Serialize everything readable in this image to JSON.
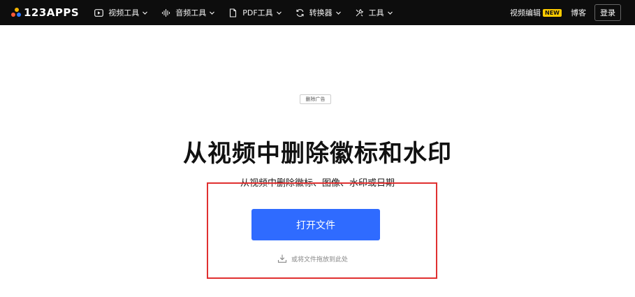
{
  "brand": {
    "name": "123APPS"
  },
  "nav": {
    "items": [
      {
        "label": "视频工具",
        "icon": "play-icon"
      },
      {
        "label": "音频工具",
        "icon": "audio-wave-icon"
      },
      {
        "label": "PDF工具",
        "icon": "document-icon"
      },
      {
        "label": "转换器",
        "icon": "convert-icon"
      },
      {
        "label": "工具",
        "icon": "tools-icon"
      }
    ]
  },
  "right_nav": {
    "video_editor": "视频编辑",
    "new_badge": "NEW",
    "blog": "博客",
    "login": "登录"
  },
  "main": {
    "remove_ads": "删除广告",
    "title": "从视频中删除徽标和水印",
    "subtitle": "从视频中删除徽标、图像、水印或日期",
    "open_file": "打开文件",
    "drop_hint": "或将文件拖放到此处"
  },
  "colors": {
    "topbar_bg": "#0d0d0d",
    "primary_button": "#2f6bff",
    "new_badge": "#ffcc00",
    "annotation": "#e03030"
  }
}
